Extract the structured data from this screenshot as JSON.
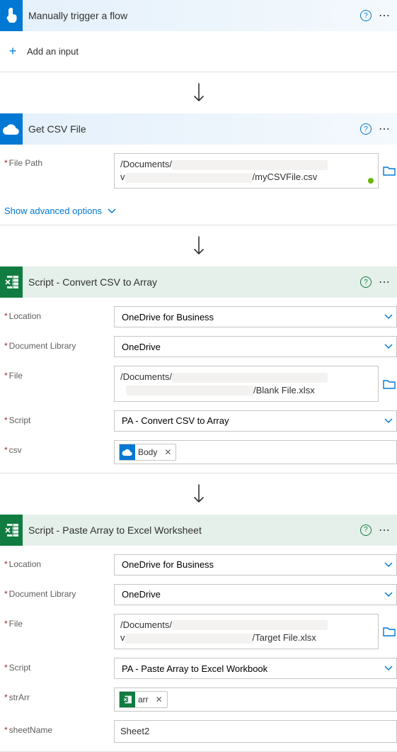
{
  "trigger": {
    "title": "Manually trigger a flow",
    "add_input": "Add an input"
  },
  "step1": {
    "title": "Get CSV File",
    "filepath_label": "File Path",
    "filepath_line1_prefix": "/Documents/",
    "filepath_line2_suffix": "/myCSVFile.csv",
    "advanced": "Show advanced options"
  },
  "step2": {
    "title": "Script - Convert CSV to Array",
    "location_label": "Location",
    "location_value": "OneDrive for Business",
    "library_label": "Document Library",
    "library_value": "OneDrive",
    "file_label": "File",
    "file_line1_prefix": "/Documents/",
    "file_line2_suffix": "/Blank File.xlsx",
    "script_label": "Script",
    "script_value": "PA - Convert CSV to Array",
    "csv_label": "csv",
    "csv_token": "Body"
  },
  "step3": {
    "title": "Script - Paste Array to Excel Worksheet",
    "location_label": "Location",
    "location_value": "OneDrive for Business",
    "library_label": "Document Library",
    "library_value": "OneDrive",
    "file_label": "File",
    "file_line1_prefix": "/Documents/",
    "file_line2_suffix": "/Target File.xlsx",
    "script_label": "Script",
    "script_value": "PA - Paste Array to Excel Workbook",
    "strarr_label": "strArr",
    "strarr_token": "arr",
    "sheetname_label": "sheetName",
    "sheetname_value": "Sheet2"
  }
}
